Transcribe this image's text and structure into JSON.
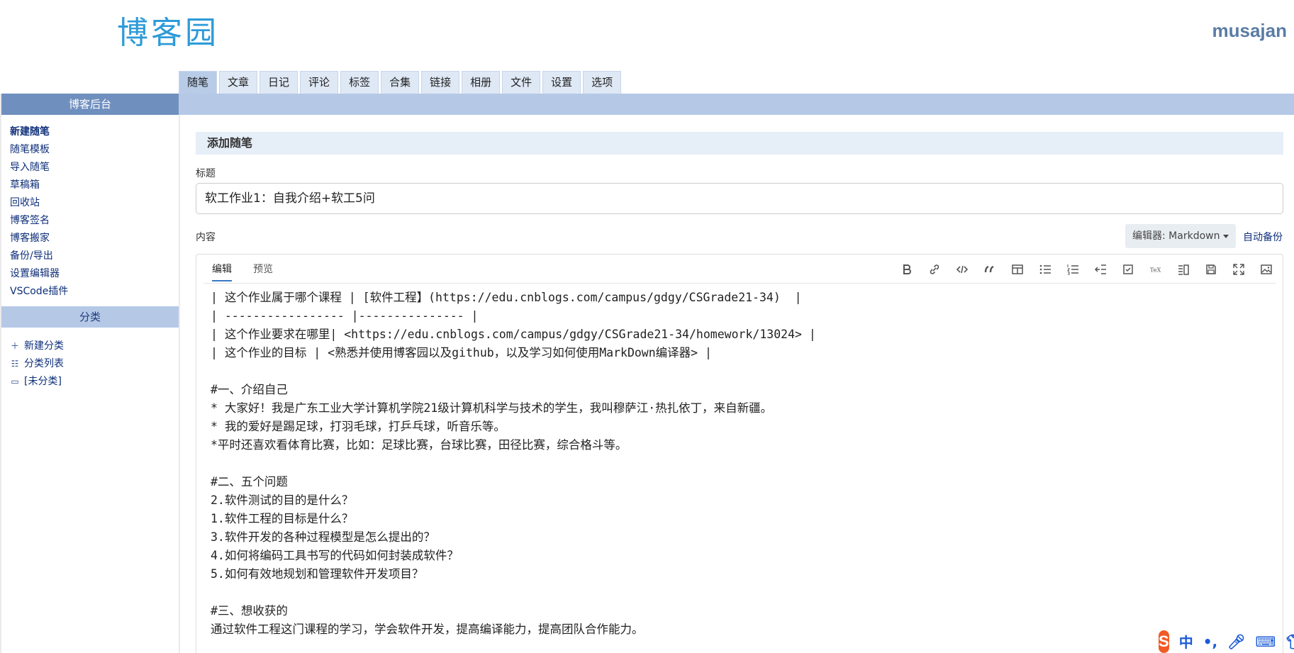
{
  "header": {
    "logo_text": "博客园",
    "username": "musajan"
  },
  "tabs": [
    "随笔",
    "文章",
    "日记",
    "评论",
    "标签",
    "合集",
    "链接",
    "相册",
    "文件",
    "设置",
    "选项"
  ],
  "sidebar": {
    "title": "博客后台",
    "links": [
      "新建随笔",
      "随笔模板",
      "导入随笔",
      "草稿箱",
      "回收站",
      "博客签名",
      "博客搬家",
      "备份/导出",
      "设置编辑器",
      "VSCode插件"
    ],
    "category_title": "分类",
    "category_links": [
      "新建分类",
      "分类列表",
      "[未分类]"
    ]
  },
  "main": {
    "section_title": "添加随笔",
    "title_label": "标题",
    "title_value": "软工作业1：自我介绍+软工5问",
    "content_label": "内容",
    "editor_select": "编辑器: Markdown",
    "autosave": "自动备份",
    "editor_tabs": [
      "编辑",
      "预览"
    ],
    "toolbar_icons": [
      "bold-icon",
      "link-icon",
      "code-icon",
      "quote-icon",
      "table-icon",
      "bullet-list-icon",
      "numbered-list-icon",
      "indent-icon",
      "checkbox-icon",
      "tex-icon",
      "preview-side-icon",
      "save-icon",
      "fullscreen-icon",
      "image-icon"
    ],
    "content_lines": [
      "| 这个作业属于哪个课程 | [软件工程】(https://edu.cnblogs.com/campus/gdgy/CSGrade21-34)  |",
      "| ----------------- |--------------- |",
      "| 这个作业要求在哪里| <https://edu.cnblogs.com/campus/gdgy/CSGrade21-34/homework/13024> |",
      "| 这个作业的目标 | <熟悉并使用博客园以及github，以及学习如何使用MarkDown编译器> |",
      "",
      "#一、介绍自己",
      "* 大家好！我是广东工业大学计算机学院21级计算机科学与技术的学生，我叫穆萨江·热扎依丁，来自新疆。",
      "* 我的爱好是踢足球，打羽毛球，打乒乓球，听音乐等。",
      "*平时还喜欢看体育比赛，比如：足球比赛，台球比赛，田径比赛，综合格斗等。",
      "",
      "#二、五个问题",
      "2.软件测试的目的是什么？",
      "1.软件工程的目标是什么？",
      "3.软件开发的各种过程模型是怎么提出的？",
      "4.如何将编码工具书写的代码如何封装成软件？",
      "5.如何有效地规划和管理软件开发项目？",
      "",
      "#三、想收获的",
      "通过软件工程这门课程的学习，学会软件开发，提高编译能力，提高团队合作能力。"
    ]
  },
  "ime": {
    "logo": "S",
    "lang": "中",
    "punct": "•,"
  }
}
